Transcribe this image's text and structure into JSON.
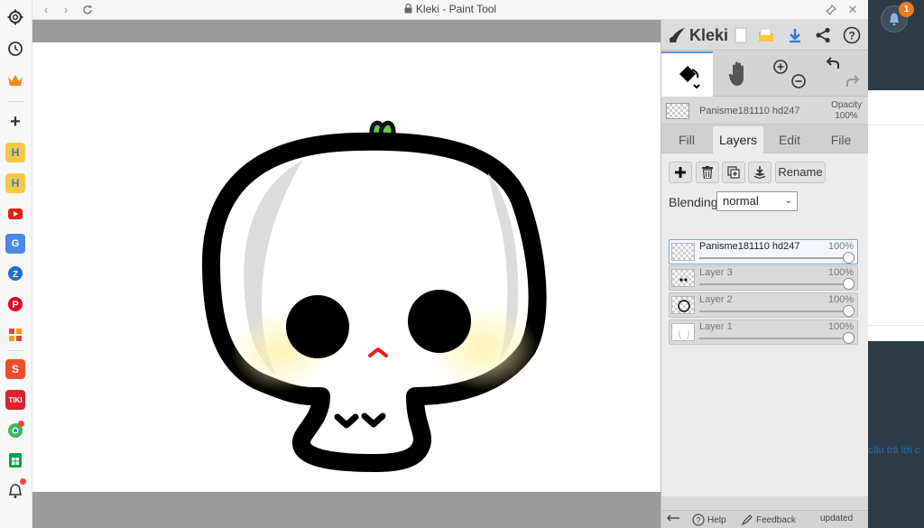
{
  "window": {
    "title": "Kleki - Paint Tool"
  },
  "browser_sidebar": {
    "icons": [
      "settings-icon",
      "history-icon",
      "crown-icon",
      "add-icon",
      "app-h-icon",
      "app-h2-icon",
      "youtube-icon",
      "translate-icon",
      "app-blue-icon",
      "pinterest-icon",
      "app-grid-icon",
      "shopee-icon",
      "tiki-icon",
      "chrome-ext-icon",
      "sheets-icon",
      "notification-bell-icon"
    ]
  },
  "kleki": {
    "logo_text": "Kleki",
    "current_layer": {
      "name": "Panisme181110 hd247",
      "opacity_label": "Opacity",
      "opacity_value": "100%"
    },
    "tabs": [
      "Fill",
      "Layers",
      "Edit",
      "File"
    ],
    "active_tab": "Layers",
    "buttons": {
      "rename": "Rename"
    },
    "blending": {
      "label": "Blending",
      "value": "normal"
    },
    "layers": [
      {
        "name": "Panisme181110 hd247",
        "opacity": "100%",
        "selected": true
      },
      {
        "name": "Layer 3",
        "opacity": "100%",
        "selected": false
      },
      {
        "name": "Layer 2",
        "opacity": "100%",
        "selected": false
      },
      {
        "name": "Layer 1",
        "opacity": "100%",
        "selected": false
      }
    ],
    "footer": {
      "help": "Help",
      "feedback": "Feedback",
      "updated": "updated"
    }
  },
  "right_strip": {
    "badge_count": "1",
    "snippet_text": "câu trả lời c"
  },
  "colors": {
    "accent_blue": "#2b7bd6",
    "badge_orange": "#f07c1e",
    "panel_bg": "#d9d9d9"
  }
}
